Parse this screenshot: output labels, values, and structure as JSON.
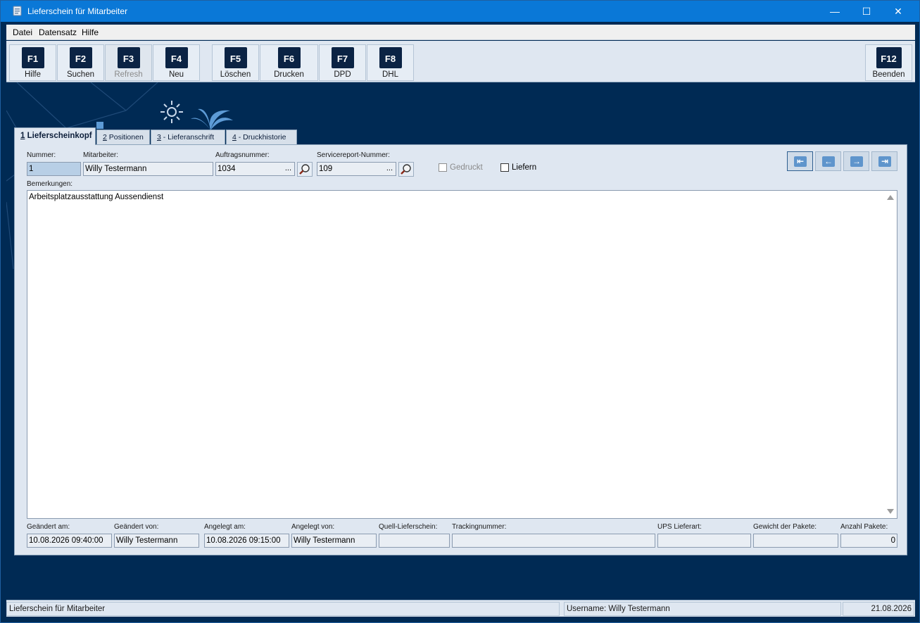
{
  "window": {
    "title": "Lieferschein für Mitarbeiter",
    "controls": {
      "minimize": "—",
      "maximize": "☐",
      "close": "✕"
    }
  },
  "menu": [
    {
      "label": "Datei"
    },
    {
      "label": "Datensatz"
    },
    {
      "label": "Hilfe"
    }
  ],
  "toolbar": {
    "buttons": [
      {
        "key": "F1",
        "label": "Hilfe",
        "enabled": true
      },
      {
        "key": "F2",
        "label": "Suchen",
        "enabled": true
      },
      {
        "key": "F3",
        "label": "Refresh",
        "enabled": false
      },
      {
        "key": "F4",
        "label": "Neu",
        "enabled": true
      },
      {
        "key": "F5",
        "label": "Löschen",
        "enabled": true
      },
      {
        "key": "F6",
        "label": "Drucken",
        "enabled": true
      },
      {
        "key": "F7",
        "label": "DPD",
        "enabled": true
      },
      {
        "key": "F8",
        "label": "DHL",
        "enabled": true
      },
      {
        "key": "F12",
        "label": "Beenden",
        "enabled": true
      }
    ]
  },
  "tabs": [
    {
      "num": "1",
      "label": " Lieferscheinkopf",
      "active": true
    },
    {
      "num": "2",
      "label": " Positionen",
      "active": false
    },
    {
      "num": "3",
      "label": " - Lieferanschrift",
      "active": false
    },
    {
      "num": "4",
      "label": " - Druckhistorie",
      "active": false
    }
  ],
  "header_fields": {
    "nummer": {
      "label": "Nummer:",
      "value": "1"
    },
    "mitarbeiter": {
      "label": "Mitarbeiter:",
      "value": "Willy Testermann"
    },
    "auftragsnummer": {
      "label": "Auftragsnummer:",
      "value": "1034",
      "ellipsis": "..."
    },
    "servicereport": {
      "label": "Servicereport-Nummer:",
      "value": "109",
      "ellipsis": "..."
    },
    "gedruckt": {
      "label": "Gedruckt",
      "checked": false,
      "enabled": false
    },
    "liefern": {
      "label": "Liefern",
      "checked": false,
      "enabled": true
    }
  },
  "navigation": {
    "first": "⇤",
    "prev": "←",
    "next": "→",
    "last": "⇥"
  },
  "bemerkungen": {
    "label": "Bemerkungen:",
    "value": "Arbeitsplatzausstattung Aussendienst"
  },
  "footer_fields": {
    "geaendert_am": {
      "label": "Geändert am:",
      "value": "10.08.2026 09:40:00"
    },
    "geaendert_von": {
      "label": "Geändert von:",
      "value": "Willy Testermann"
    },
    "angelegt_am": {
      "label": "Angelegt am:",
      "value": "10.08.2026 09:15:00"
    },
    "angelegt_von": {
      "label": "Angelegt von:",
      "value": "Willy Testermann"
    },
    "quell_lieferschein": {
      "label": "Quell-Lieferschein:",
      "value": ""
    },
    "trackingnummer": {
      "label": "Trackingnummer:",
      "value": ""
    },
    "ups_lieferart": {
      "label": "UPS Lieferart:",
      "value": ""
    },
    "gewicht": {
      "label": "Gewicht der Pakete:",
      "value": ""
    },
    "anzahl_pakete": {
      "label": "Anzahl Pakete:",
      "value": "0"
    }
  },
  "statusbar": {
    "left": "Lieferschein für Mitarbeiter",
    "user": "Username: Willy Testermann",
    "date": "21.08.2026"
  },
  "colors": {
    "titlebar": "#0a78d7",
    "background": "#002a54",
    "panel": "#dfe7f1",
    "key_badge": "#0b2344",
    "nav_accent": "#5f95cc"
  }
}
